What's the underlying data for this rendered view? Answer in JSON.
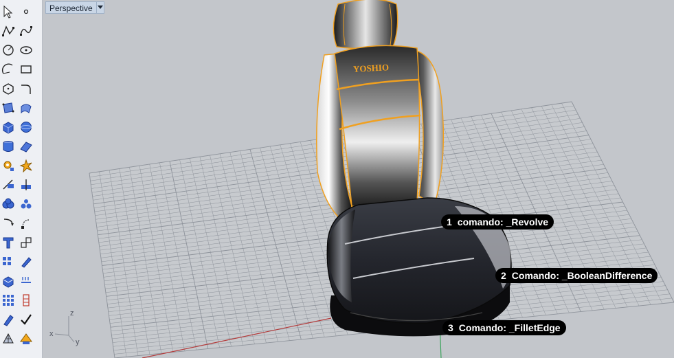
{
  "viewport": {
    "title": "Perspective",
    "background": "#c3c6cb",
    "grid_color": "#8e939b",
    "x_axis_color": "#b33a3a",
    "y_axis_color": "#3aa35a",
    "selection_color": "#f0a020"
  },
  "model": {
    "logo_text": "YOSHIO"
  },
  "captions": [
    {
      "number": "1",
      "text": "comando: _Revolve"
    },
    {
      "number": "2",
      "text": "Comando: _BooleanDifference"
    },
    {
      "number": "3",
      "text": "Comando: _FilletEdge"
    }
  ],
  "axis_widget": {
    "z": "z",
    "x": "x",
    "y": "y"
  },
  "toolbar": {
    "tools": [
      [
        "select-arrow-icon",
        "point-icon"
      ],
      [
        "polyline-icon",
        "curve-icon"
      ],
      [
        "circle-icon",
        "ellipse-icon"
      ],
      [
        "arc-icon",
        "rectangle-icon"
      ],
      [
        "polygon-icon",
        "fillet-curve-icon"
      ],
      [
        "surface-points-icon",
        "surface-edge-icon"
      ],
      [
        "box-icon",
        "sphere-icon"
      ],
      [
        "cylinder-icon",
        "planar-surface-icon"
      ],
      [
        "gear-settings-icon",
        "explode-icon"
      ],
      [
        "split-icon",
        "trim-icon"
      ],
      [
        "boolean-union-icon",
        "boolean-split-icon"
      ],
      [
        "revolve-icon",
        "rail-revolve-icon"
      ],
      [
        "text-icon",
        "scale-icon"
      ],
      [
        "array-icon",
        "edit-icon"
      ],
      [
        "extrude-icon",
        "dimension-icon"
      ],
      [
        "grid-array-icon",
        "history-icon"
      ],
      [
        "pipe-icon",
        "check-icon"
      ],
      [
        "mesh-icon",
        "render-icon"
      ]
    ]
  }
}
